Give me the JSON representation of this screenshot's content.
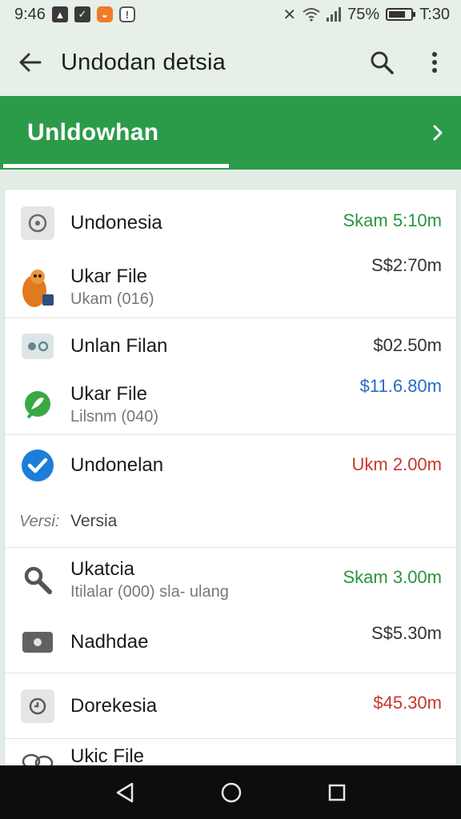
{
  "status_bar": {
    "time": "9:46",
    "battery_text": "75%",
    "clock_right": "T:30",
    "battery_level": 0.75
  },
  "app_bar": {
    "title": "Undodan detsia",
    "back_icon": "arrow-left-icon",
    "search_icon": "search-icon",
    "menu_icon": "more-vert-icon"
  },
  "tab_bar": {
    "label": "Unldowhan",
    "chevron_icon": "chevron-right-icon",
    "color": "#2b9b49"
  },
  "list": {
    "items": [
      {
        "name": "Undonesia",
        "sub": "",
        "amount": "Skam 5:10m",
        "amount_color": "green",
        "icon": "compass-file-icon"
      },
      {
        "name": "Ukar File",
        "sub": "Ukam (016)",
        "amount": "S$2:70m",
        "amount_color": "dark",
        "icon": "fox-mascot-icon"
      },
      {
        "name": "Unlan Filan",
        "sub": "",
        "amount": "$02.50m",
        "amount_color": "dark",
        "icon": "cassette-icon"
      },
      {
        "name": "Ukar File",
        "sub": "Lilsnm (040)",
        "amount": "$11.6.80m",
        "amount_color": "blue",
        "icon": "green-leaf-icon"
      },
      {
        "name": "Undonelan",
        "sub": "",
        "amount": "Ukm 2.00m",
        "amount_color": "red",
        "icon": "check-circle-icon"
      },
      {
        "name": "Versia",
        "sub": "",
        "prefix": "Versi:",
        "amount": "",
        "amount_color": "dark",
        "icon": ""
      },
      {
        "name": "Ukatcia",
        "sub": "Itilalar (000) sla- ulang",
        "amount": "Skam 3.00m",
        "amount_color": "green",
        "icon": "wrench-icon"
      },
      {
        "name": "Nadhdae",
        "sub": "",
        "amount": "S$5.30m",
        "amount_color": "dark",
        "icon": "camera-icon"
      },
      {
        "name": "Dorekesia",
        "sub": "",
        "amount": "$45.30m",
        "amount_color": "red",
        "icon": "clock-icon"
      },
      {
        "name": "Ukic File",
        "sub": "",
        "amount": "",
        "amount_color": "dark",
        "icon": "link-icon"
      }
    ]
  },
  "nav_bar": {
    "back_icon": "nav-back-icon",
    "home_icon": "nav-home-icon",
    "recents_icon": "nav-recents-icon"
  }
}
